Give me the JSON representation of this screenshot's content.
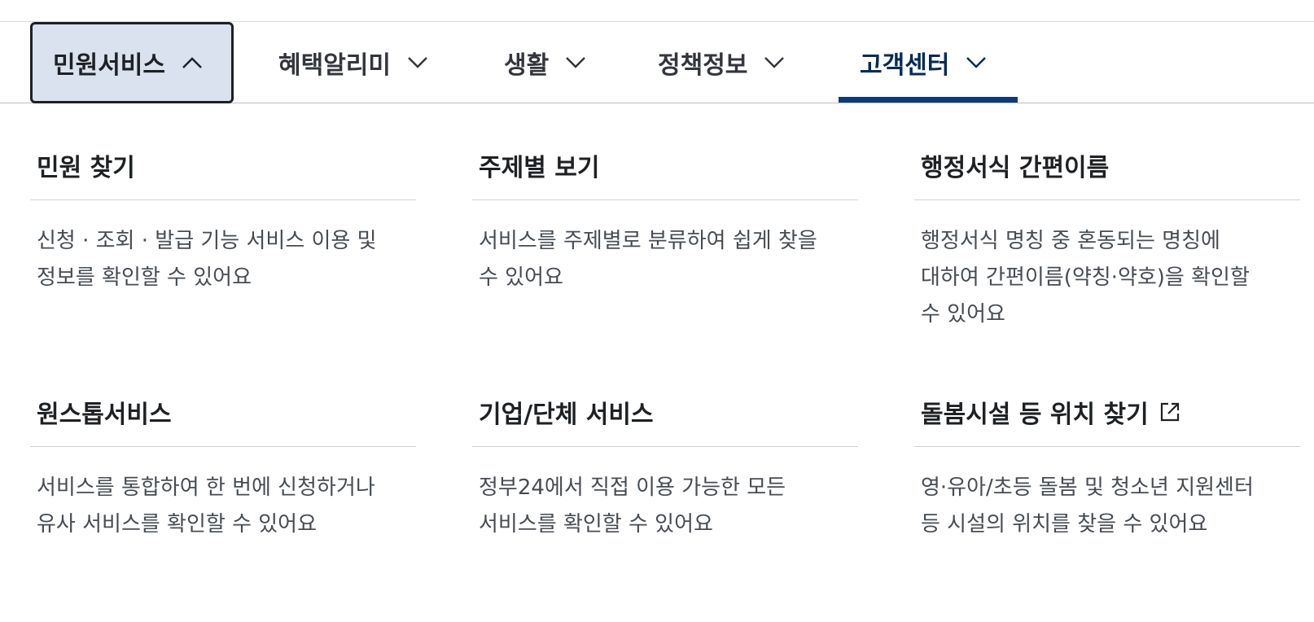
{
  "nav": {
    "items": [
      {
        "label": "민원서비스",
        "icon": "chevron-up-icon"
      },
      {
        "label": "혜택알리미",
        "icon": "chevron-down-icon"
      },
      {
        "label": "생활",
        "icon": "chevron-down-icon"
      },
      {
        "label": "정책정보",
        "icon": "chevron-down-icon"
      },
      {
        "label": "고객센터",
        "icon": "chevron-down-icon"
      }
    ],
    "colors": {
      "open_bg": "#d9e2ee",
      "current_bar": "#0b3b75"
    }
  },
  "menu": {
    "cards": [
      {
        "title": "민원 찾기",
        "desc_lines": [
          "신청 · 조회 · 발급 기능 서비스 이용 및",
          "정보를 확인할 수 있어요"
        ]
      },
      {
        "title": "주제별 보기",
        "desc_lines": [
          "서비스를 주제별로 분류하여 쉽게 찾을",
          "수 있어요"
        ]
      },
      {
        "title": "행정서식 간편이름",
        "desc_lines": [
          "행정서식 명칭 중 혼동되는 명칭에",
          "대하여 간편이름(약칭·약호)을 확인할",
          "수 있어요"
        ]
      },
      {
        "title": "원스톱서비스",
        "desc_lines": [
          "서비스를 통합하여 한 번에 신청하거나",
          "유사 서비스를 확인할 수 있어요"
        ]
      },
      {
        "title": "기업/단체 서비스",
        "desc_lines": [
          "정부24에서 직접 이용 가능한 모든",
          "서비스를 확인할 수 있어요"
        ]
      },
      {
        "title": "돌봄시설 등 위치 찾기",
        "icon": "external-link-icon",
        "desc_lines": [
          "영·유아/초등 돌봄 및 청소년 지원센터",
          "등 시설의 위치를 찾을 수 있어요"
        ]
      }
    ]
  }
}
